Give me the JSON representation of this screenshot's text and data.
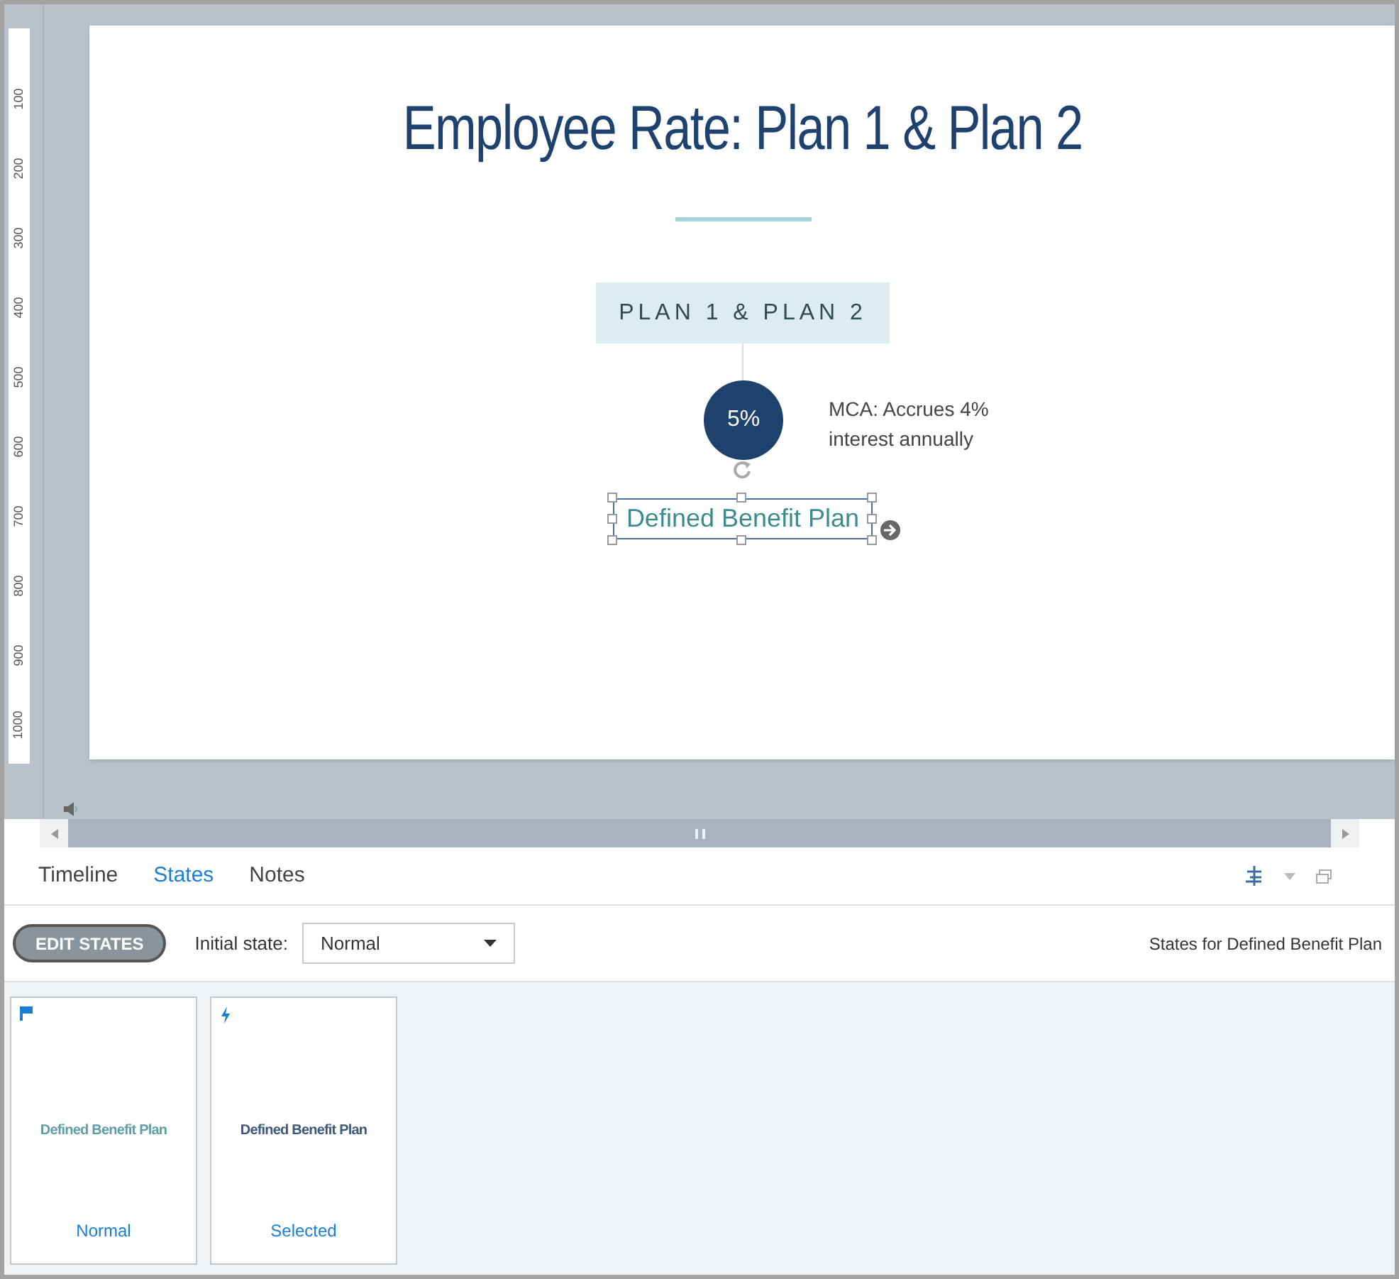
{
  "ruler": {
    "labels": [
      "100",
      "200",
      "300",
      "400",
      "500",
      "600",
      "700",
      "800",
      "900",
      "1000"
    ]
  },
  "slide": {
    "title": "Employee Rate: Plan 1 & Plan 2",
    "plan_label": "PLAN 1 & PLAN 2",
    "percent": "5%",
    "note": "MCA: Accrues 4% interest annually",
    "selected_object": "Defined Benefit Plan"
  },
  "tabs": [
    {
      "label": "Timeline",
      "selected": false
    },
    {
      "label": "States",
      "selected": true
    },
    {
      "label": "Notes",
      "selected": false
    }
  ],
  "toolbar": {
    "edit_button": "EDIT STATES",
    "initial_state_label": "Initial state:",
    "initial_state_value": "Normal",
    "states_for": "States for Defined Benefit Plan"
  },
  "states": [
    {
      "kind": "normal",
      "preview": "Defined Benefit Plan",
      "name": "Normal"
    },
    {
      "kind": "selected",
      "preview": "Defined Benefit Plan",
      "name": "Selected"
    }
  ]
}
